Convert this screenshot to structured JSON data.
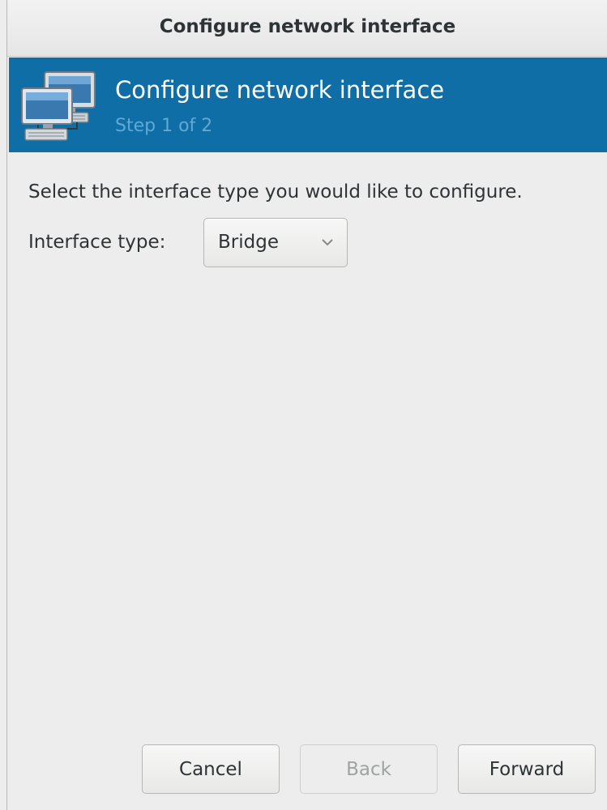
{
  "window": {
    "title": "Configure network interface"
  },
  "banner": {
    "icon": "network-computers-icon",
    "title": "Configure network interface",
    "subtitle": "Step 1 of 2",
    "background_color": "#0f6ea6"
  },
  "content": {
    "instruction": "Select the interface type you would like to configure.",
    "interface_type_label": "Interface type:",
    "interface_type_value": "Bridge"
  },
  "buttons": {
    "cancel": "Cancel",
    "back": "Back",
    "forward": "Forward",
    "back_enabled": false
  }
}
